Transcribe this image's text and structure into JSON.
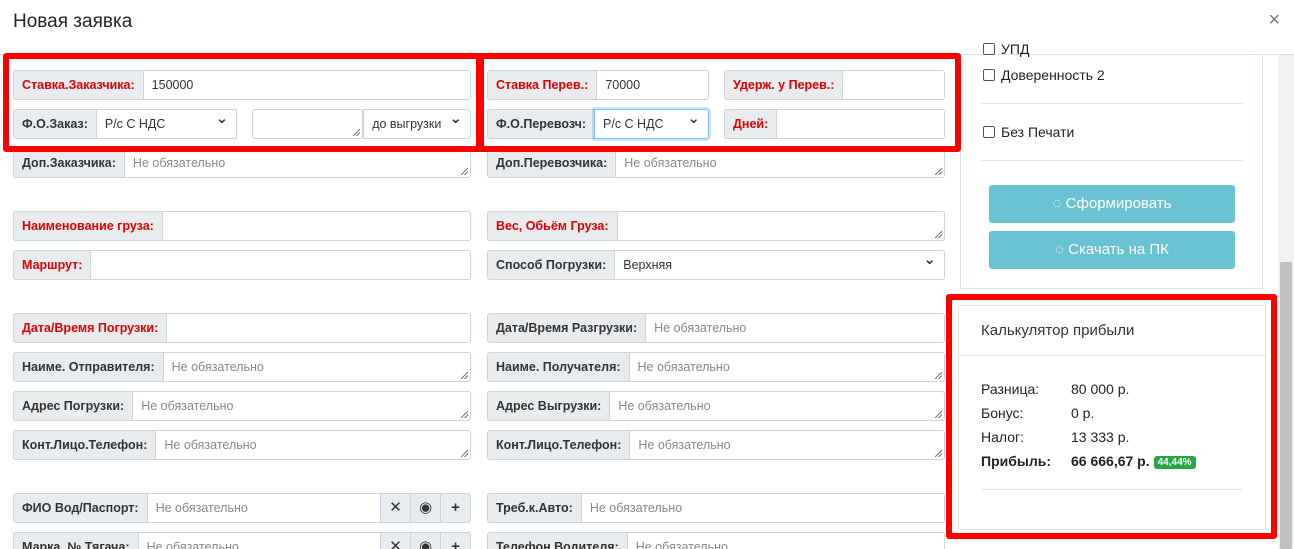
{
  "modal": {
    "title": "Новая заявка",
    "close": "×"
  },
  "left": {
    "customer_rate_label": "Ставка.Заказчика:",
    "customer_rate_value": "150000",
    "payment_form_label": "Ф.О.Заказ:",
    "payment_form_value": "Р/с С НДС",
    "payment_term_value": "до выгрузки",
    "customer_extra_label": "Доп.Заказчика:",
    "customer_extra_placeholder": "Не обязательно",
    "cargo_name_label": "Наименование груза:",
    "route_label": "Маршрут:",
    "load_datetime_label": "Дата/Время Погрузки:",
    "sender_label": "Наиме. Отправителя:",
    "sender_placeholder": "Не обязательно",
    "load_address_label": "Адрес Погрузки:",
    "load_address_placeholder": "Не обязательно",
    "contact_label": "Конт.Лицо.Телефон:",
    "contact_placeholder": "Не обязательно",
    "driver_label": "ФИО Вод/Паспорт:",
    "driver_placeholder": "Не обязательно",
    "truck_label": "Марка, № Тягача:",
    "truck_placeholder": "Не обязательно"
  },
  "right": {
    "carrier_rate_label": "Ставка Перев.:",
    "carrier_rate_value": "70000",
    "withhold_label": "Удерж. у Перев.:",
    "carrier_payment_label": "Ф.О.Перевозч:",
    "carrier_payment_value": "Р/с С НДС",
    "days_label": "Дней:",
    "carrier_extra_label": "Доп.Перевозчика:",
    "carrier_extra_placeholder": "Не обязательно",
    "weight_label": "Вес, Обьём Груза:",
    "loading_method_label": "Способ Погрузки:",
    "loading_method_value": "Верхняя",
    "unload_datetime_label": "Дата/Время Разгрузки:",
    "unload_datetime_placeholder": "Не обязательно",
    "receiver_label": "Наиме. Получателя:",
    "receiver_placeholder": "Не обязательно",
    "unload_address_label": "Адрес Выгрузки:",
    "unload_address_placeholder": "Не обязательно",
    "contact_label": "Конт.Лицо.Телефон:",
    "contact_placeholder": "Не обязательно",
    "car_req_label": "Треб.к.Авто:",
    "car_req_placeholder": "Не обязательно",
    "driver_phone_label": "Телефон Водителя:",
    "driver_phone_placeholder": "Не обязательно"
  },
  "side": {
    "checkbox_upd": "УПД",
    "checkbox_proxy": "Доверенность 2",
    "checkbox_nostamp": "Без Печати",
    "generate_button": "Сформировать",
    "download_button": "Скачать на ПК"
  },
  "calculator": {
    "title": "Калькулятор прибыли",
    "difference_label": "Разница:",
    "difference_value": "80 000 р.",
    "bonus_label": "Бонус:",
    "bonus_value": "0 р.",
    "tax_label": "Налог:",
    "tax_value": "13 333 р.",
    "profit_label": "Прибыль:",
    "profit_value": "66 666,67 р.",
    "profit_percent": "44,44%"
  },
  "icons": {
    "clear": "close-icon",
    "view": "eye-icon",
    "add": "plus-icon",
    "spinner": "spinner-icon"
  },
  "colors": {
    "required_label": "#e00000",
    "highlight_border": "#ff0000",
    "button_info": "#6ac3d3",
    "badge_success": "#28a745"
  }
}
